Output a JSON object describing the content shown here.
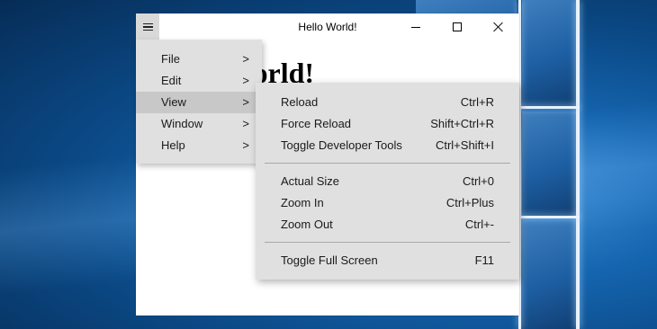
{
  "window": {
    "title": "Hello World!",
    "heading": "Hello World!"
  },
  "titlebar_icons": {
    "menu": "hamburger-icon",
    "minimize": "minimize-icon",
    "maximize": "maximize-icon",
    "close": "close-icon"
  },
  "main_menu": {
    "items": [
      {
        "label": "File",
        "chevron": ">"
      },
      {
        "label": "Edit",
        "chevron": ">"
      },
      {
        "label": "View",
        "chevron": ">"
      },
      {
        "label": "Window",
        "chevron": ">"
      },
      {
        "label": "Help",
        "chevron": ">"
      }
    ],
    "active_item": "View"
  },
  "view_menu": {
    "groups": [
      [
        {
          "label": "Reload",
          "accelerator": "Ctrl+R"
        },
        {
          "label": "Force Reload",
          "accelerator": "Shift+Ctrl+R"
        },
        {
          "label": "Toggle Developer Tools",
          "accelerator": "Ctrl+Shift+I"
        }
      ],
      [
        {
          "label": "Actual Size",
          "accelerator": "Ctrl+0"
        },
        {
          "label": "Zoom In",
          "accelerator": "Ctrl+Plus"
        },
        {
          "label": "Zoom Out",
          "accelerator": "Ctrl+-"
        }
      ],
      [
        {
          "label": "Toggle Full Screen",
          "accelerator": "F11"
        }
      ]
    ]
  },
  "colors": {
    "menu_background": "#e0e0e0",
    "menu_highlight": "#c8c8c8",
    "desktop_blue": "#1565b0"
  }
}
